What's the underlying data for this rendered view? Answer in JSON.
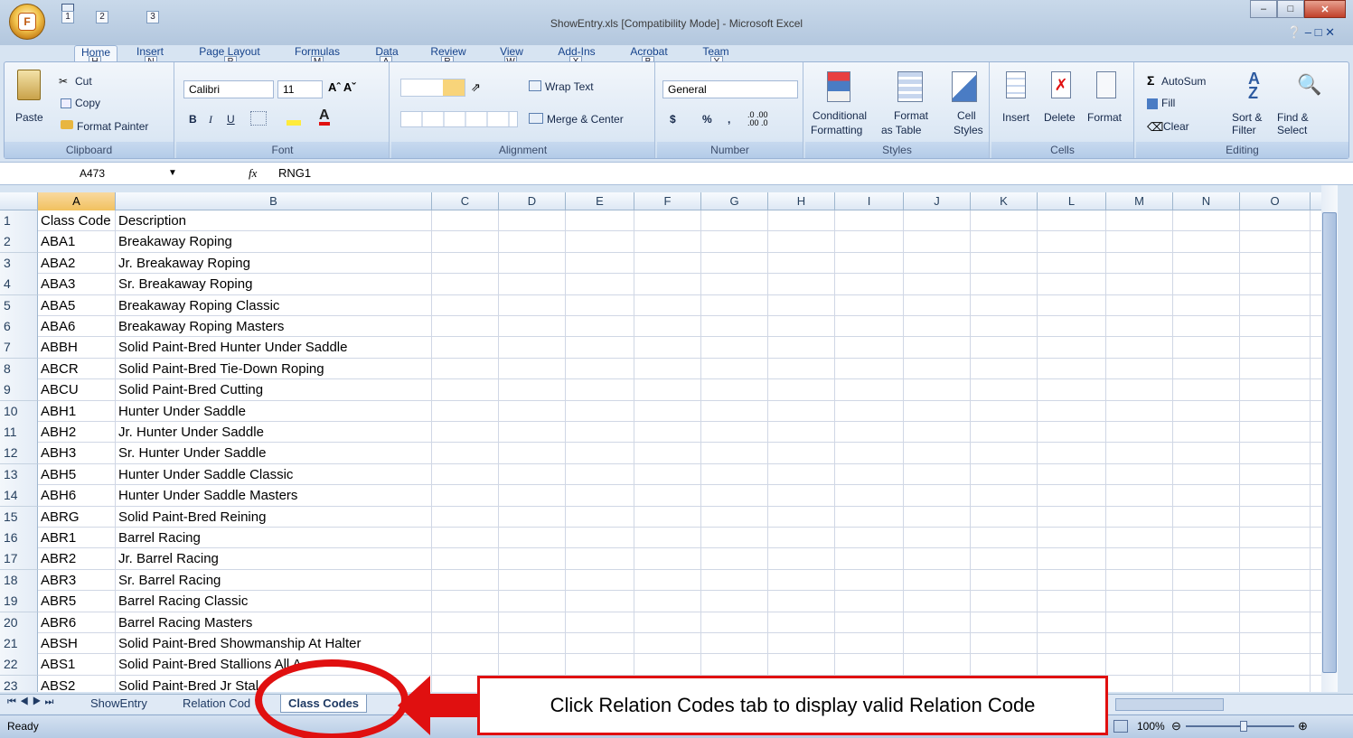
{
  "window": {
    "title": "ShowEntry.xls  [Compatibility Mode] - Microsoft Excel",
    "office_button_keytip": "F",
    "qat_keytips": [
      "1",
      "2",
      "3"
    ]
  },
  "ribbon_tabs": [
    {
      "label": "Home",
      "key": "H"
    },
    {
      "label": "Insert",
      "key": "N"
    },
    {
      "label": "Page Layout",
      "key": "P"
    },
    {
      "label": "Formulas",
      "key": "M"
    },
    {
      "label": "Data",
      "key": "A"
    },
    {
      "label": "Review",
      "key": "R"
    },
    {
      "label": "View",
      "key": "W"
    },
    {
      "label": "Add-Ins",
      "key": "X"
    },
    {
      "label": "Acrobat",
      "key": "B"
    },
    {
      "label": "Team",
      "key": "Y"
    }
  ],
  "clipboard": {
    "paste": "Paste",
    "cut": "Cut",
    "copy": "Copy",
    "format_painter": "Format Painter",
    "label": "Clipboard"
  },
  "font": {
    "name": "Calibri",
    "size": "11",
    "label": "Font",
    "bold": "B",
    "italic": "I",
    "underline": "U"
  },
  "alignment": {
    "wrap": "Wrap Text",
    "merge": "Merge & Center",
    "label": "Alignment"
  },
  "number": {
    "format": "General",
    "currency": "$",
    "percent": "%",
    "comma": ",",
    "label": "Number"
  },
  "styles": {
    "conditional1": "Conditional",
    "conditional2": "Formatting",
    "format_table1": "Format",
    "format_table2": "as Table",
    "cell_styles1": "Cell",
    "cell_styles2": "Styles",
    "label": "Styles"
  },
  "cells": {
    "insert": "Insert",
    "delete": "Delete",
    "format": "Format",
    "label": "Cells"
  },
  "editing": {
    "autosum": "AutoSum",
    "fill": "Fill",
    "clear": "Clear",
    "sort1": "Sort &",
    "sort2": "Filter",
    "find1": "Find &",
    "find2": "Select",
    "label": "Editing"
  },
  "formula_bar": {
    "name_box": "A473",
    "fx": "fx",
    "formula": "RNG1"
  },
  "columns": [
    "A",
    "B",
    "C",
    "D",
    "E",
    "F",
    "G",
    "H",
    "I",
    "J",
    "K",
    "L",
    "M",
    "N",
    "O"
  ],
  "rows": [
    {
      "n": "1",
      "a": "Class Code",
      "b": "Description"
    },
    {
      "n": "2",
      "a": "ABA1",
      "b": "Breakaway Roping"
    },
    {
      "n": "3",
      "a": "ABA2",
      "b": "Jr. Breakaway Roping"
    },
    {
      "n": "4",
      "a": "ABA3",
      "b": "Sr. Breakaway Roping"
    },
    {
      "n": "5",
      "a": "ABA5",
      "b": "Breakaway Roping Classic"
    },
    {
      "n": "6",
      "a": "ABA6",
      "b": "Breakaway Roping Masters"
    },
    {
      "n": "7",
      "a": "ABBH",
      "b": "Solid Paint-Bred Hunter Under Saddle"
    },
    {
      "n": "8",
      "a": "ABCR",
      "b": "Solid Paint-Bred Tie-Down Roping"
    },
    {
      "n": "9",
      "a": "ABCU",
      "b": "Solid Paint-Bred Cutting"
    },
    {
      "n": "10",
      "a": "ABH1",
      "b": "Hunter Under Saddle"
    },
    {
      "n": "11",
      "a": "ABH2",
      "b": "Jr. Hunter Under Saddle"
    },
    {
      "n": "12",
      "a": "ABH3",
      "b": "Sr. Hunter Under Saddle"
    },
    {
      "n": "13",
      "a": "ABH5",
      "b": "Hunter Under Saddle Classic"
    },
    {
      "n": "14",
      "a": "ABH6",
      "b": "Hunter Under Saddle Masters"
    },
    {
      "n": "15",
      "a": "ABRG",
      "b": "Solid Paint-Bred Reining"
    },
    {
      "n": "16",
      "a": "ABR1",
      "b": "Barrel Racing"
    },
    {
      "n": "17",
      "a": "ABR2",
      "b": "Jr. Barrel Racing"
    },
    {
      "n": "18",
      "a": "ABR3",
      "b": "Sr. Barrel Racing"
    },
    {
      "n": "19",
      "a": "ABR5",
      "b": "Barrel Racing Classic"
    },
    {
      "n": "20",
      "a": "ABR6",
      "b": "Barrel Racing Masters"
    },
    {
      "n": "21",
      "a": "ABSH",
      "b": "Solid Paint-Bred Showmanship At Halter"
    },
    {
      "n": "22",
      "a": "ABS1",
      "b": "Solid Paint-Bred Stallions All A"
    },
    {
      "n": "23",
      "a": "ABS2",
      "b": "Solid Paint-Bred Jr Stal"
    }
  ],
  "sheet_tabs": [
    "ShowEntry",
    "Relation Cod",
    "Class Codes"
  ],
  "status": {
    "ready": "Ready",
    "zoom": "100%"
  },
  "annotation": {
    "text": "Click Relation Codes tab to display valid Relation Code"
  },
  "colors": {
    "accent": "#15428b",
    "annotation": "#e01010",
    "selected_header": "#f1c15f"
  }
}
